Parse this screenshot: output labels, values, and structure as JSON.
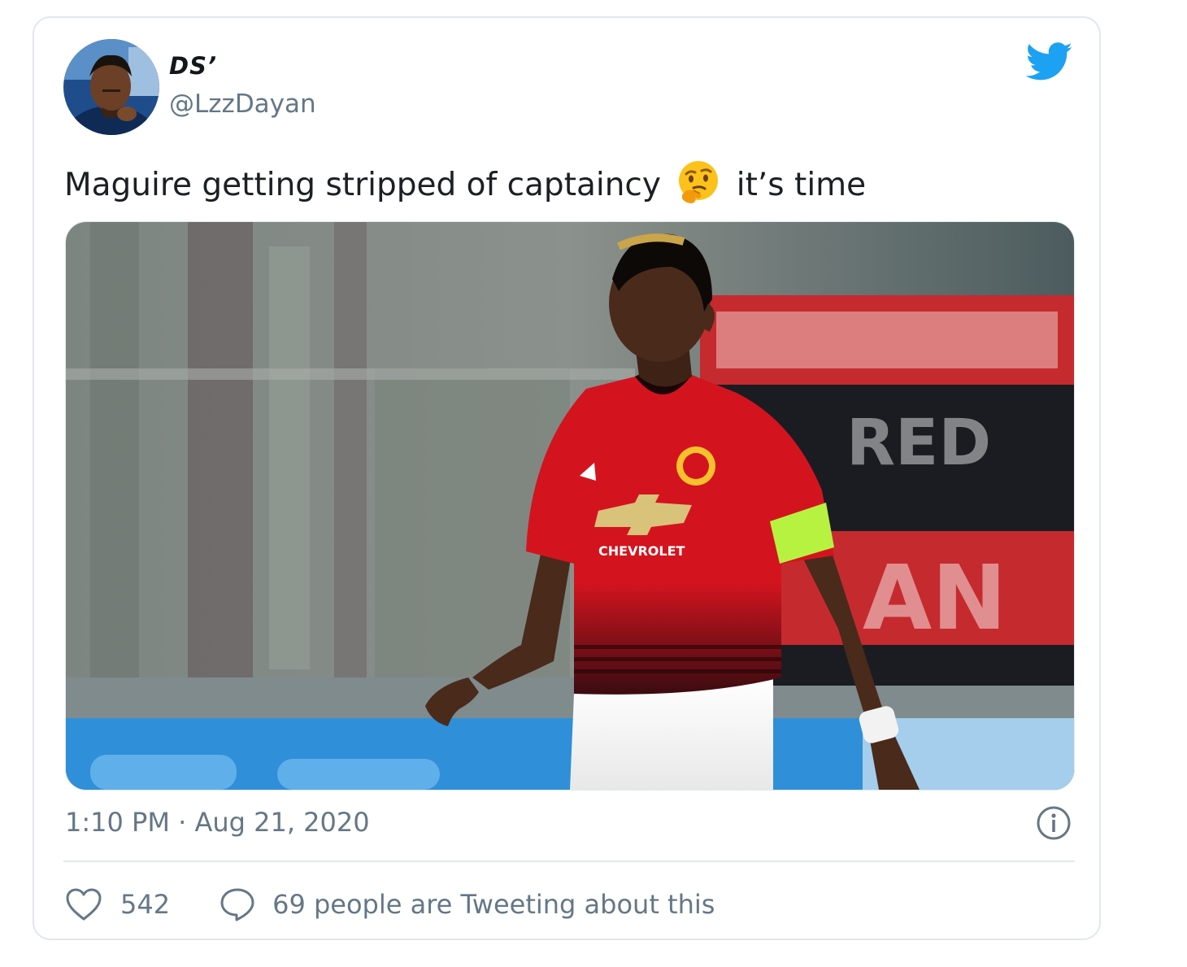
{
  "tweet": {
    "author_name": "DSʼ",
    "author_handle": "@LzzDayan",
    "text_before_emoji": "Maguire getting stripped of captaincy",
    "text_after_emoji": "it’s time",
    "emoji": "thinking-face-icon",
    "timestamp": "1:10 PM · Aug 21, 2020",
    "like_count": "542",
    "reply_text": "69 people are Tweeting about this"
  },
  "media": {
    "shirt_text": "CHEVROLET",
    "banner_text_1": "RED",
    "banner_text_2": "AN"
  },
  "icons": {
    "brand": "twitter-bird-icon",
    "info": "info-icon",
    "like": "heart-icon",
    "reply": "speech-bubble-icon"
  },
  "colors": {
    "twitter_blue": "#1da1f2",
    "secondary_text": "#657786",
    "border": "#e1e8ed",
    "jersey_red": "#d3141f",
    "armband_green": "#b8f240"
  }
}
